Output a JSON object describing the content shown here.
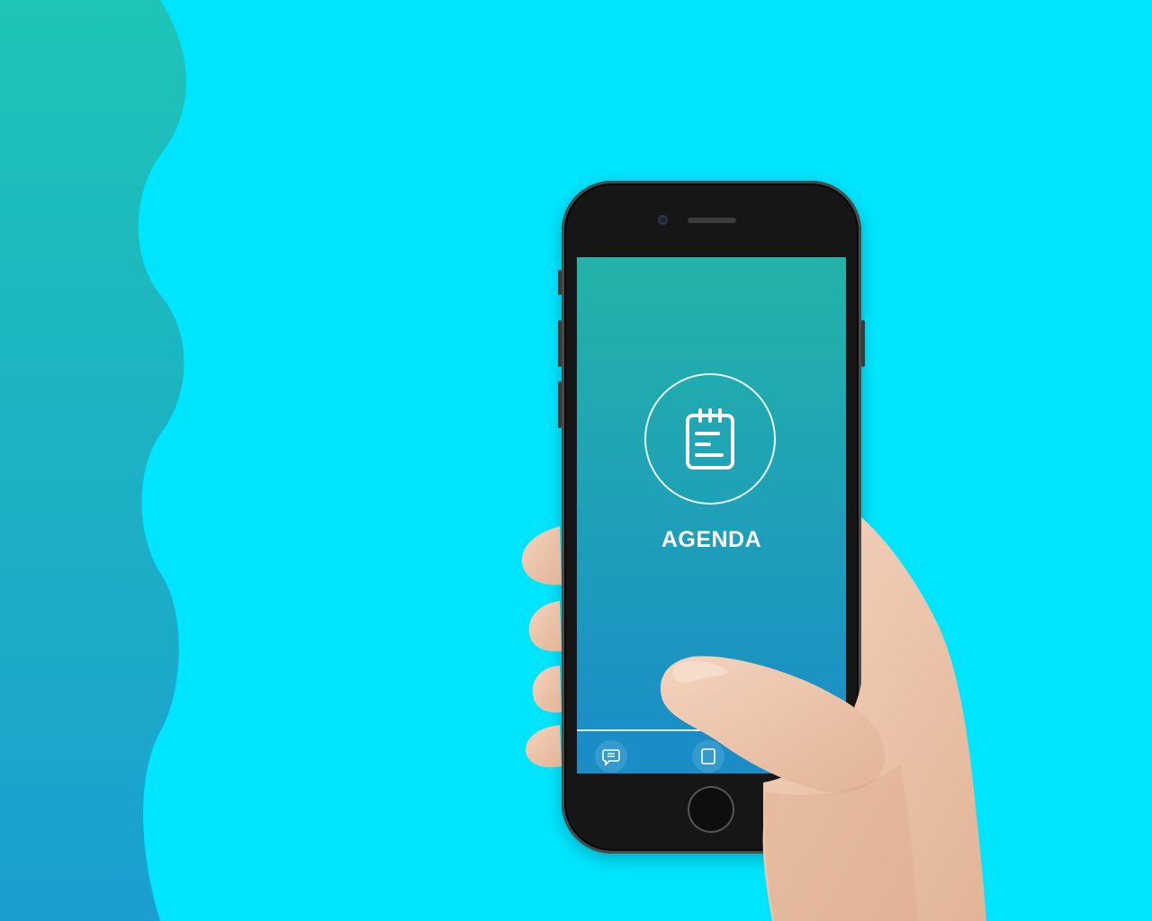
{
  "colors": {
    "background": "#00e5ff",
    "wave_top": "#1ec4b6",
    "wave_bottom": "#1a9fd0",
    "screen_top": "#23b3a8",
    "screen_bottom": "#1a8cc8"
  },
  "app": {
    "title": "AGENDA",
    "title_icon": "notepad-icon",
    "tab_bar": {
      "items": [
        {
          "icon": "chat-icon"
        },
        {
          "icon": "tab-icon"
        }
      ]
    }
  }
}
